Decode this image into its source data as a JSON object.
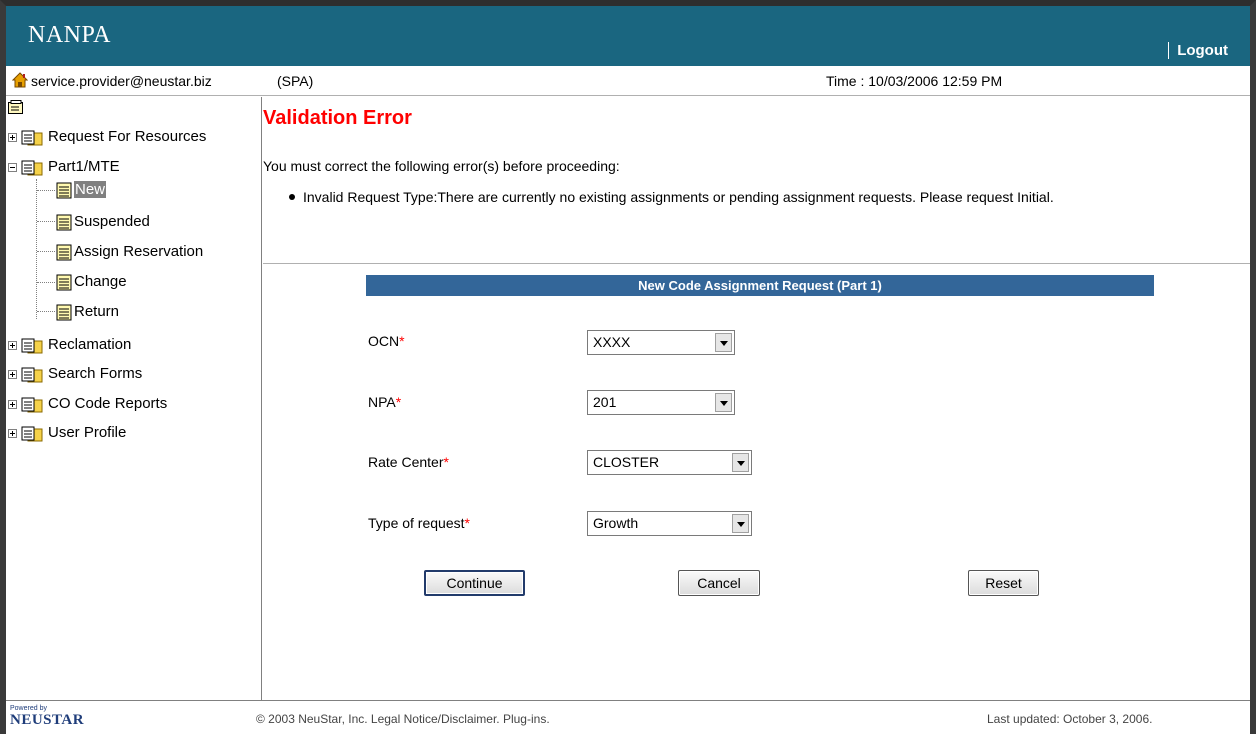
{
  "header": {
    "brand": "NANPA",
    "logout_label": "Logout"
  },
  "userbar": {
    "email": "service.provider@neustar.biz",
    "role": "(SPA)",
    "time": "Time : 10/03/2006 12:59 PM"
  },
  "sidebar": {
    "items": [
      {
        "label": "Request For Resources",
        "expander": "plus"
      },
      {
        "label": "Part1/MTE",
        "expander": "minus",
        "children": [
          {
            "label": "New",
            "selected": true
          },
          {
            "label": "Suspended"
          },
          {
            "label": "Assign Reservation"
          },
          {
            "label": "Change"
          },
          {
            "label": "Return"
          }
        ]
      },
      {
        "label": "Reclamation",
        "expander": "plus"
      },
      {
        "label": "Search Forms",
        "expander": "plus"
      },
      {
        "label": "CO Code Reports",
        "expander": "plus"
      },
      {
        "label": "User Profile",
        "expander": "plus"
      }
    ]
  },
  "validation": {
    "title": "Validation Error",
    "message": "You must correct the following error(s) before proceeding:",
    "errors": [
      "Invalid Request Type:There are currently no existing assignments or pending assignment requests. Please request Initial."
    ]
  },
  "form": {
    "title": "New Code Assignment Request (Part 1)",
    "required_marker": "*",
    "fields": [
      {
        "label": "OCN",
        "value": "XXXX"
      },
      {
        "label": "NPA",
        "value": "201"
      },
      {
        "label": "Rate Center",
        "value": "CLOSTER"
      },
      {
        "label": "Type of request",
        "value": "Growth"
      }
    ],
    "buttons": {
      "continue": "Continue",
      "cancel": "Cancel",
      "reset": "Reset"
    }
  },
  "footer": {
    "powered_by": "Powered by",
    "logo": "NEUSTAR",
    "copyright": "© 2003 NeuStar, Inc. Legal Notice/Disclaimer. Plug-ins.",
    "last_updated": "Last updated: October 3, 2006."
  },
  "colors": {
    "header_bg": "#1a6680",
    "form_header_bg": "#336699",
    "error_red": "#ff0000"
  }
}
